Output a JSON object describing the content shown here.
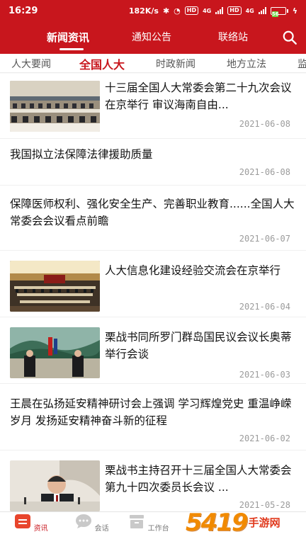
{
  "status_bar": {
    "time": "16:29",
    "network_speed": "182K/s",
    "hd_badge_1": "HD",
    "network_1": "4G",
    "hd_badge_2": "HD",
    "network_2": "4G",
    "battery_label": "56",
    "battery_level": 0.56
  },
  "top_nav": {
    "tabs": [
      {
        "label": "新闻资讯",
        "active": true
      },
      {
        "label": "通知公告",
        "active": false
      },
      {
        "label": "联络站",
        "active": false
      }
    ]
  },
  "sub_nav": {
    "tabs": [
      {
        "label": "人大要闻",
        "active": false
      },
      {
        "label": "全国人大",
        "active": true
      },
      {
        "label": "时政新闻",
        "active": false
      },
      {
        "label": "地方立法",
        "active": false
      },
      {
        "label": "监",
        "active": false
      }
    ]
  },
  "news": [
    {
      "title": "十三届全国人大常委会第二十九次会议在京举行 审议海南自由...",
      "date": "2021-06-08",
      "has_image": true
    },
    {
      "title": "我国拟立法保障法律援助质量",
      "date": "2021-06-08",
      "has_image": false
    },
    {
      "title": "保障医师权利、强化安全生产、完善职业教育......全国人大常委会会议看点前瞻",
      "date": "2021-06-07",
      "has_image": false
    },
    {
      "title": "人大信息化建设经验交流会在京举行",
      "date": "2021-06-04",
      "has_image": true
    },
    {
      "title": "栗战书同所罗门群岛国民议会议长奥蒂举行会谈",
      "date": "2021-06-03",
      "has_image": true
    },
    {
      "title": "王晨在弘扬延安精神研讨会上强调 学习辉煌党史 重温峥嵘岁月 发扬延安精神奋斗新的征程",
      "date": "2021-06-02",
      "has_image": false
    },
    {
      "title": "栗战书主持召开十三届全国人大常委会第九十四次委员长会议 ...",
      "date": "2021-05-28",
      "has_image": true
    }
  ],
  "bottom_nav": {
    "tabs": [
      {
        "label": "资讯",
        "active": true,
        "icon": "news-icon"
      },
      {
        "label": "会话",
        "active": false,
        "icon": "chat-icon"
      },
      {
        "label": "工作台",
        "active": false,
        "icon": "workbench-icon"
      }
    ]
  },
  "watermark": {
    "digits": "5419",
    "name": "手游网",
    "sub": "网"
  },
  "colors": {
    "brand_red": "#c8161d",
    "active_tab_red": "#c8161d",
    "date_gray": "#9b9b9b",
    "battery_green": "#6ddb4a"
  }
}
